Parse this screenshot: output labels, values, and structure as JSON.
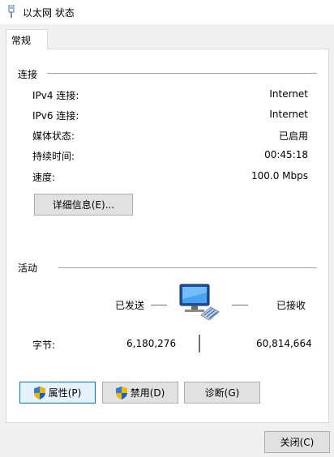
{
  "window": {
    "title": "以太网 状态"
  },
  "tab": {
    "label": "常规"
  },
  "connection": {
    "heading": "连接",
    "rows": [
      {
        "label": "IPv4 连接:",
        "value": "Internet"
      },
      {
        "label": "IPv6 连接:",
        "value": "Internet"
      },
      {
        "label": "媒体状态:",
        "value": "已启用"
      },
      {
        "label": "持续时间:",
        "value": "00:45:18"
      },
      {
        "label": "速度:",
        "value": "100.0 Mbps"
      }
    ],
    "details_button": "详细信息(E)..."
  },
  "activity": {
    "heading": "活动",
    "sent_label": "已发送",
    "received_label": "已接收",
    "bytes_label": "字节:",
    "bytes_sent": "6,180,276",
    "bytes_received": "60,814,664"
  },
  "buttons": {
    "properties": "属性(P)",
    "disable": "禁用(D)",
    "diagnose": "诊断(G)",
    "close": "关闭(C)"
  },
  "icons": {
    "title": "network-adapter-icon",
    "network": "network-computer-icon",
    "shield": "uac-shield-icon"
  },
  "colors": {
    "accent": "#0078d7",
    "button_bg": "#e1e1e1",
    "panel_bg": "#ffffff",
    "window_bg": "#f0f0f0"
  }
}
